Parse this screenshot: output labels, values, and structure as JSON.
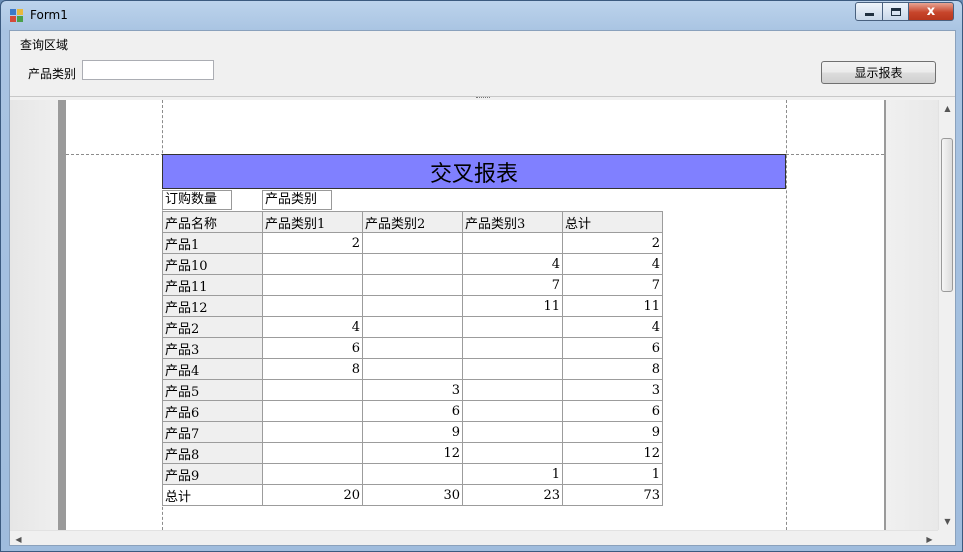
{
  "window": {
    "title": "Form1",
    "controls": {
      "minimize": "",
      "maximize": "",
      "close": "x"
    }
  },
  "query": {
    "group_title": "查询区域",
    "filter_label": "产品类别",
    "filter_value": "",
    "show_button": "显示报表"
  },
  "report": {
    "title": "交叉报表",
    "corner_label": "订购数量",
    "column_group_label": "产品类别",
    "row_header_label": "产品名称",
    "columns": [
      "产品类别1",
      "产品类别2",
      "产品类别3",
      "总计"
    ],
    "rows": [
      {
        "name": "产品1",
        "values": [
          "2",
          "",
          "",
          "2"
        ]
      },
      {
        "name": "产品10",
        "values": [
          "",
          "",
          "4",
          "4"
        ]
      },
      {
        "name": "产品11",
        "values": [
          "",
          "",
          "7",
          "7"
        ]
      },
      {
        "name": "产品12",
        "values": [
          "",
          "",
          "11",
          "11"
        ]
      },
      {
        "name": "产品2",
        "values": [
          "4",
          "",
          "",
          "4"
        ]
      },
      {
        "name": "产品3",
        "values": [
          "6",
          "",
          "",
          "6"
        ]
      },
      {
        "name": "产品4",
        "values": [
          "8",
          "",
          "",
          "8"
        ]
      },
      {
        "name": "产品5",
        "values": [
          "",
          "3",
          "",
          "3"
        ]
      },
      {
        "name": "产品6",
        "values": [
          "",
          "6",
          "",
          "6"
        ]
      },
      {
        "name": "产品7",
        "values": [
          "",
          "9",
          "",
          "9"
        ]
      },
      {
        "name": "产品8",
        "values": [
          "",
          "12",
          "",
          "12"
        ]
      },
      {
        "name": "产品9",
        "values": [
          "",
          "",
          "1",
          "1"
        ]
      }
    ],
    "total_row": {
      "name": "总计",
      "values": [
        "20",
        "30",
        "23",
        "73"
      ]
    }
  },
  "scrollbar": {
    "up": "▲",
    "down": "▼",
    "left": "◀",
    "right": "▶"
  },
  "colors": {
    "title_band": "#8080ff",
    "header_fill": "#efefef",
    "close_button": "#c7452b"
  }
}
